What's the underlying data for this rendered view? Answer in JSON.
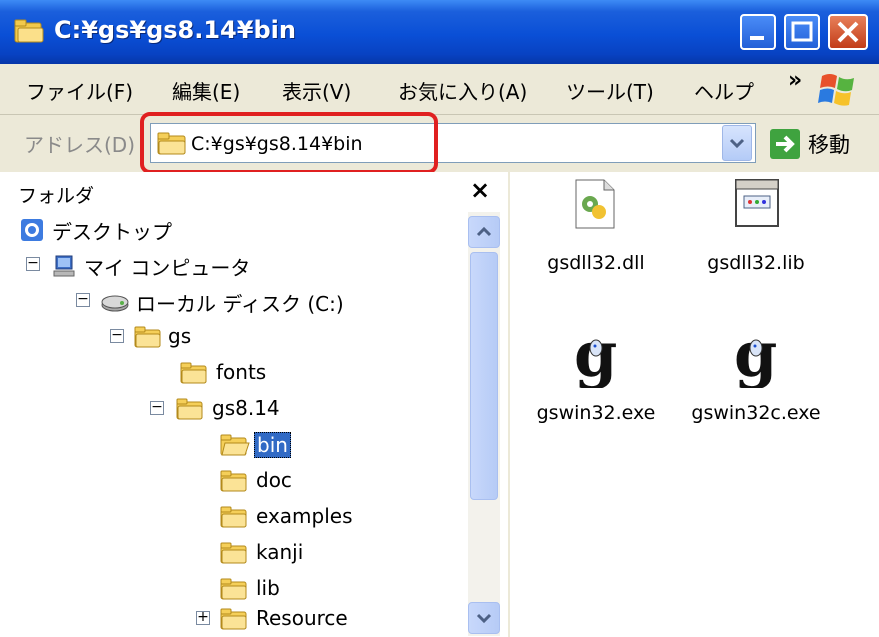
{
  "window": {
    "title": "C:¥gs¥gs8.14¥bin"
  },
  "menu": {
    "items": [
      "ファイル(F)",
      "編集(E)",
      "表示(V)",
      "お気に入り(A)",
      "ツール(T)",
      "ヘルプ"
    ],
    "more": "»"
  },
  "address": {
    "label": "アドレス(D)",
    "path": "C:¥gs¥gs8.14¥bin",
    "go_label": "移動"
  },
  "folders": {
    "title": "フォルダ",
    "close": "×",
    "tree": [
      {
        "label": "デスクトップ",
        "icon": "desktop-icon"
      },
      {
        "label": "マイ コンピュータ",
        "icon": "my-computer-icon"
      },
      {
        "label": "ローカル ディスク (C:)",
        "icon": "local-disk-icon"
      },
      {
        "label": "gs",
        "icon": "folder-icon"
      },
      {
        "label": "fonts",
        "icon": "folder-icon"
      },
      {
        "label": "gs8.14",
        "icon": "folder-icon"
      },
      {
        "label": "bin",
        "icon": "folder-open-icon",
        "selected": true
      },
      {
        "label": "doc",
        "icon": "folder-icon"
      },
      {
        "label": "examples",
        "icon": "folder-icon"
      },
      {
        "label": "kanji",
        "icon": "folder-icon"
      },
      {
        "label": "lib",
        "icon": "folder-icon"
      },
      {
        "label": "Resource",
        "icon": "folder-icon"
      }
    ]
  },
  "files": [
    {
      "name": "gsdll32.dll",
      "icon": "dll-file-icon"
    },
    {
      "name": "gsdll32.lib",
      "icon": "lib-file-icon"
    },
    {
      "name": "gswin32.exe",
      "icon": "ghostscript-icon"
    },
    {
      "name": "gswin32c.exe",
      "icon": "ghostscript-icon"
    }
  ],
  "colors": {
    "titlebar": "#0a4fd6",
    "selection": "#316ac5",
    "highlight_box": "#e02020"
  }
}
